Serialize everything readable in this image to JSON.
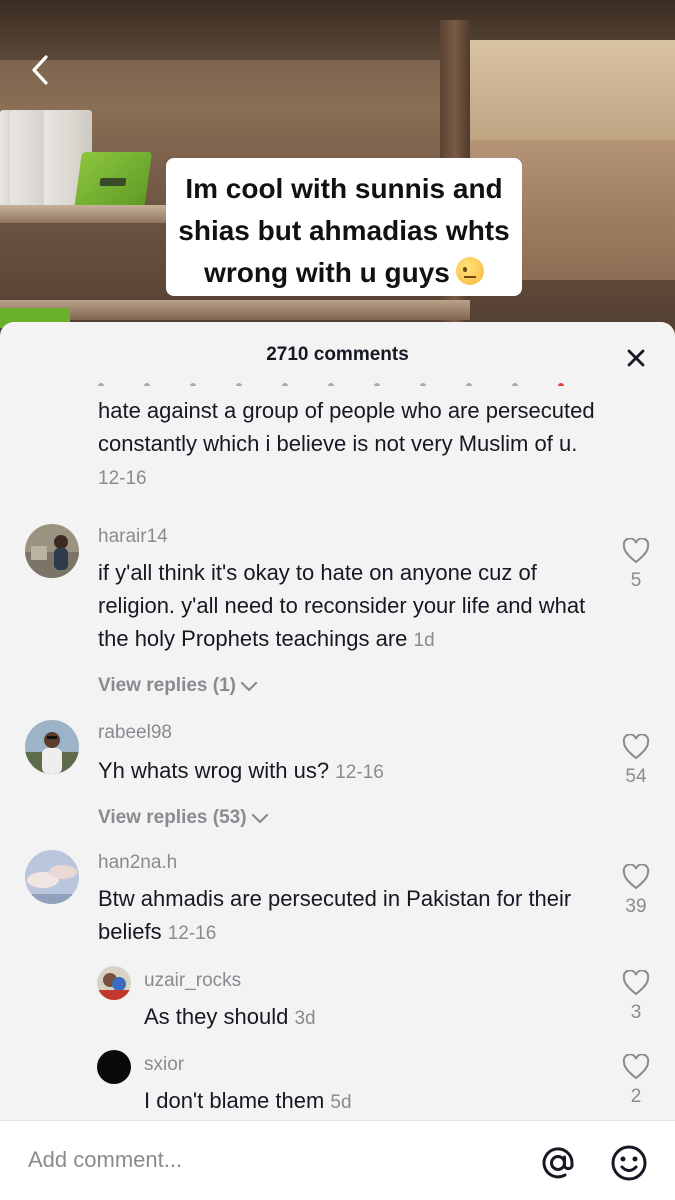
{
  "video": {
    "caption": "Im cool with sunnis and shias but ahmadias whts wrong with u guys"
  },
  "sheet": {
    "title": "2710 comments"
  },
  "comments": [
    {
      "text": "hate against a group of people who are persecuted constantly which i believe is not very Muslim of u.",
      "time": "12-16"
    },
    {
      "username": "harair14",
      "text": "if y'all think it's okay to hate on anyone cuz of religion. y'all need to reconsider your life and what the holy Prophets teachings are",
      "time": "1d",
      "likes": "5",
      "view_replies": "View replies (1)"
    },
    {
      "username": "rabeel98",
      "text": "Yh whats wrog with us?",
      "time": "12-16",
      "likes": "54",
      "view_replies": "View replies (53)"
    },
    {
      "username": "han2na.h",
      "text": "Btw ahmadis are persecuted in Pakistan for their beliefs",
      "time": "12-16",
      "likes": "39"
    }
  ],
  "replies": [
    {
      "username": "uzair_rocks",
      "text": "As they should",
      "time": "3d",
      "likes": "3"
    },
    {
      "username": "sxior",
      "text": "I don't blame them",
      "time": "5d",
      "likes": "2"
    }
  ],
  "input": {
    "placeholder": "Add comment..."
  },
  "icons": {
    "back": "chevron-left-icon",
    "close": "close-icon",
    "like": "heart-outline-icon",
    "mention": "at-sign-icon",
    "emoji": "smiley-icon"
  }
}
